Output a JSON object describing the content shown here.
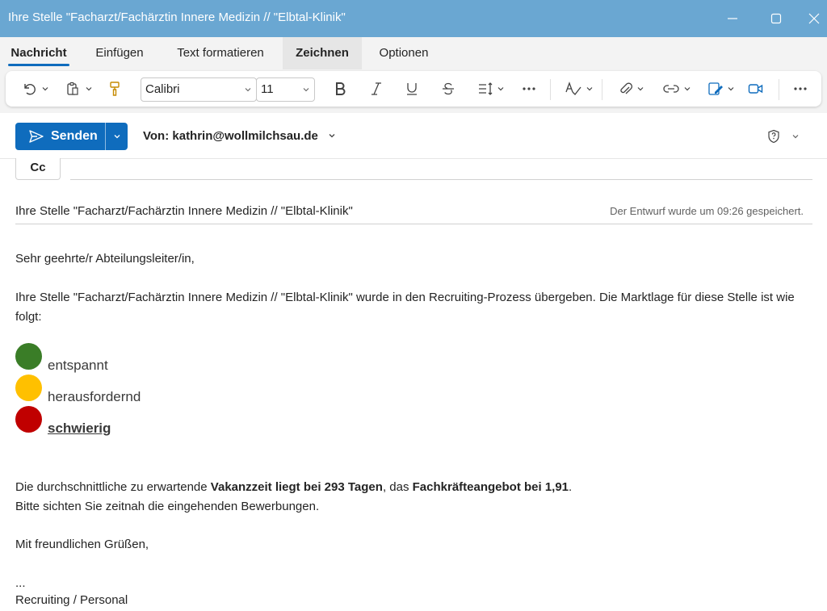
{
  "window": {
    "title": "Ihre Stelle \"Facharzt/Fachärztin Innere Medizin // \"Elbtal-Klinik\""
  },
  "ribbon": {
    "tabs": [
      "Nachricht",
      "Einfügen",
      "Text formatieren",
      "Zeichnen",
      "Optionen"
    ],
    "active_tab": "Nachricht"
  },
  "toolbar": {
    "font_name": "Calibri",
    "font_size": "11"
  },
  "compose": {
    "send_label": "Senden",
    "from_label": "Von: kathrin@wollmilchsau.de",
    "cc_label": "Cc",
    "subject": "Ihre Stelle \"Facharzt/Fachärztin Innere Medizin // \"Elbtal-Klinik\"",
    "saved_status": "Der Entwurf wurde um 09:26 gespeichert."
  },
  "body": {
    "greeting": "Sehr geehrte/r Abteilungsleiter/in,",
    "intro_line1": "Ihre Stelle \"Facharzt/Fachärztin Innere Medizin // \"Elbtal-Klinik\" wurde in den Recruiting-Prozess übergeben. Die Marktlage für diese Stelle ist wie",
    "intro_line2": "folgt:",
    "market": [
      {
        "label": "entspannt",
        "color": "#3a7d27",
        "selected": false
      },
      {
        "label": "herausfordernd",
        "color": "#ffc000",
        "selected": false
      },
      {
        "label": "schwierig",
        "color": "#c00000",
        "selected": true
      }
    ],
    "stat_prefix": "Die durchschnittliche zu erwartende ",
    "stat_bold1": "Vakanzzeit liegt bei 293 Tagen",
    "stat_mid": ", das ",
    "stat_bold2": "Fachkräfteangebot bei 1,91",
    "stat_suffix": ".",
    "request": "Bitte sichten Sie zeitnah die eingehenden Bewerbungen.",
    "closing": "Mit freundlichen Grüßen,",
    "ellipsis": "...",
    "signature": "Recruiting / Personal"
  },
  "colors": {
    "titlebar": "#6aa7d2",
    "accent": "#0f6cbd"
  }
}
